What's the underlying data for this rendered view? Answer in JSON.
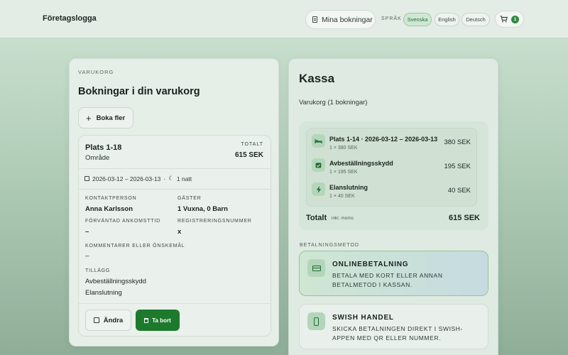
{
  "header": {
    "logo": "Företagslogga",
    "my_bookings": "Mina bokningar",
    "language_label": "SPRÅK",
    "languages": [
      "Svenska",
      "English",
      "Deutsch"
    ],
    "active_language": "Svenska",
    "cart_count": "1"
  },
  "cart": {
    "eyebrow": "VARUKORG",
    "title": "Bokningar i din varukorg",
    "book_more": "Boka fler",
    "booking": {
      "title": "Plats 1-18",
      "subtitle": "Område",
      "total_label": "TOTALT",
      "total": "615 SEK",
      "dates": "2026-03-12 – 2026-03-13",
      "separator": "·",
      "nights": "1 natt",
      "contact_label": "KONTAKTPERSON",
      "contact": "Anna Karlsson",
      "guests_label": "GÄSTER",
      "guests": "1 Vuxna, 0 Barn",
      "arrival_label": "FÖRVÄNTAD ANKOMSTTID",
      "arrival": "–",
      "registration_label": "REGISTRERINGSNUMMER",
      "registration": "x",
      "comments_label": "KOMMENTARER ELLER ÖNSKEMÅL",
      "comments": "–",
      "addons_label": "TILLÄGG",
      "addons": [
        "Avbeställningsskydd",
        "Elanslutning"
      ],
      "edit": "Ändra",
      "delete": "Ta bort"
    }
  },
  "checkout": {
    "title": "Kassa",
    "summary": "Varukorg (1 bokningar)",
    "lines": [
      {
        "name": "Plats 1-14 · 2026-03-12 – 2026-03-13",
        "qty": "1 × 380 SEK",
        "price": "380 SEK",
        "icon": "bed-icon"
      },
      {
        "name": "Avbeställningsskydd",
        "qty": "1 × 195 SEK",
        "price": "195 SEK",
        "icon": "calendar-check-icon"
      },
      {
        "name": "Elanslutning",
        "qty": "1 × 40 SEK",
        "price": "40 SEK",
        "icon": "bolt-icon"
      }
    ],
    "total_label": "Totalt",
    "total_note": "inkl. moms",
    "total": "615 SEK",
    "payment_label": "BETALNINGSMETOD",
    "payment_methods": [
      {
        "title": "ONLINEBETALNING",
        "description": "BETALA MED KORT ELLER ANNAN BETALMETOD I KASSAN.",
        "selected": true,
        "icon": "credit-card-icon"
      },
      {
        "title": "SWISH HANDEL",
        "description": "SKICKA BETALNINGEN DIREKT I SWISH-APPEN MED QR ELLER NUMMER.",
        "selected": false,
        "icon": "phone-icon"
      }
    ]
  },
  "colors": {
    "accent": "#1d7a2c",
    "badge": "#2e8a42"
  }
}
